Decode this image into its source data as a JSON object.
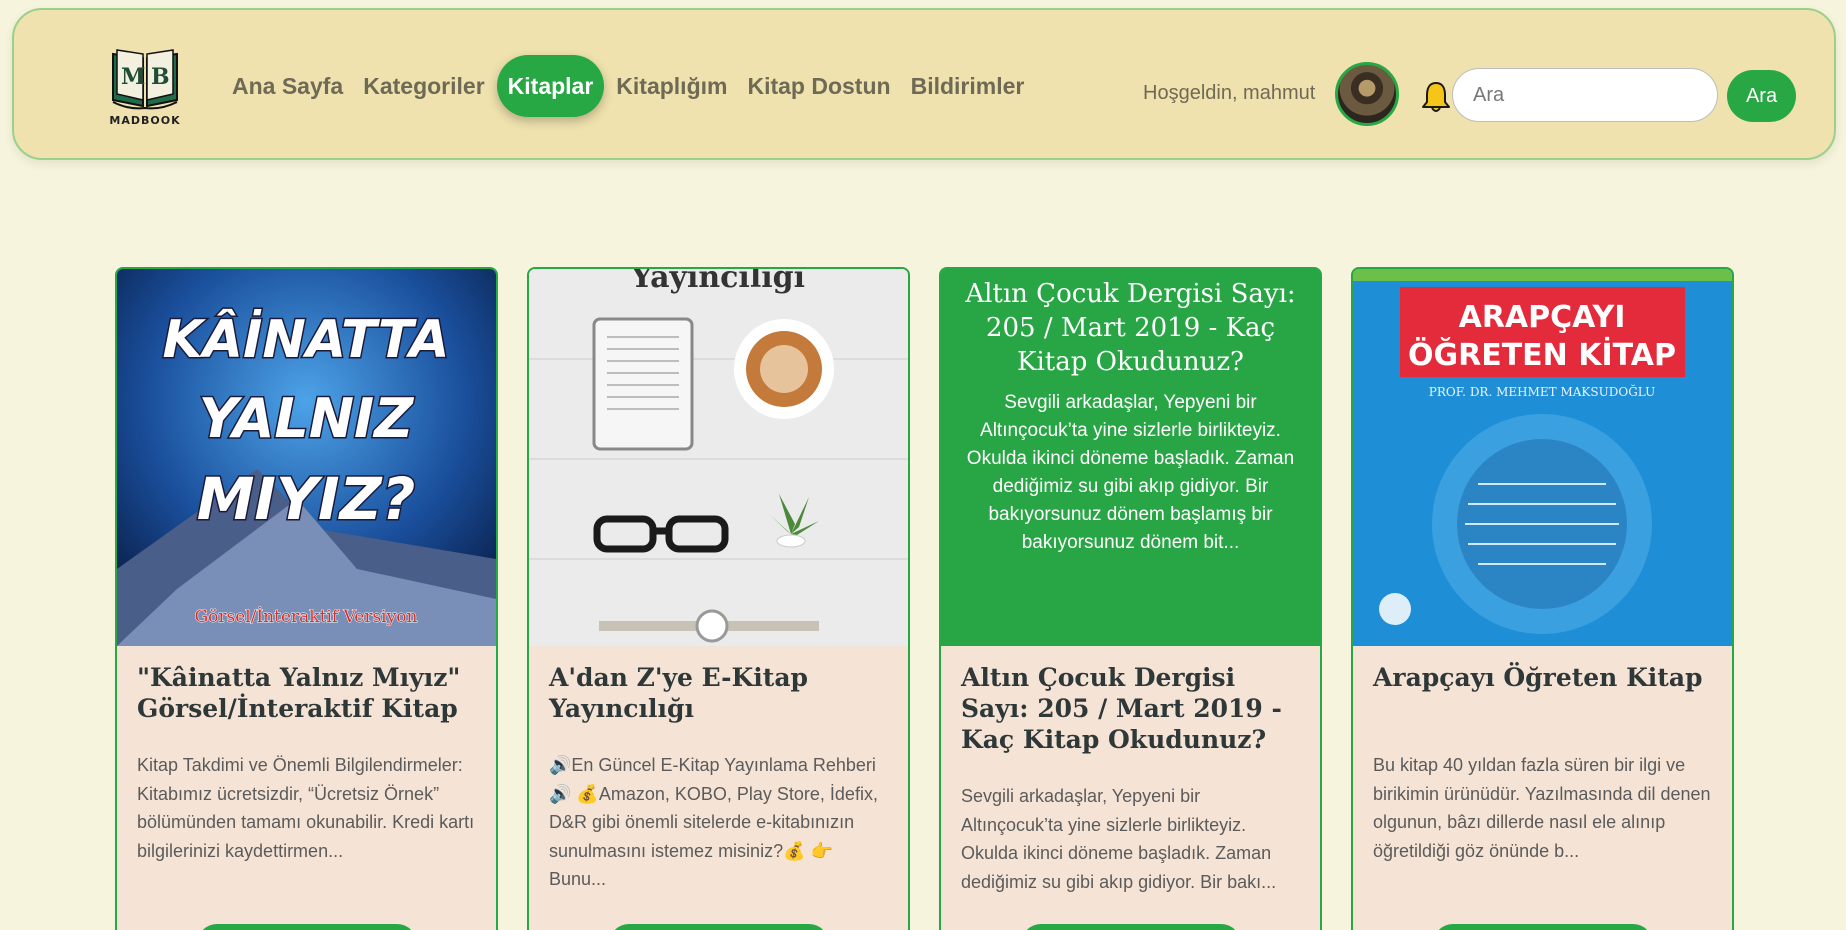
{
  "logo": {
    "monogram": "MB",
    "name": "MADBOOK"
  },
  "nav": [
    {
      "label": "Ana Sayfa"
    },
    {
      "label": "Kategoriler"
    },
    {
      "label": "Kitaplar",
      "active": true
    },
    {
      "label": "Kitaplığım"
    },
    {
      "label": "Kitap Dostun"
    },
    {
      "label": "Bildirimler"
    }
  ],
  "user": {
    "welcome": "Hoşgeldin, mahmut"
  },
  "search": {
    "placeholder": "Ara",
    "button": "Ara"
  },
  "colors": {
    "accent": "#28a745",
    "navbar_bg": "#efe2ae",
    "page_bg": "#f6f4dc",
    "card_bg": "#f5e4d6"
  },
  "cards": [
    {
      "title": "\"Kâinatta Yalnız Mıyız\" Görsel/İnteraktif Kitap",
      "description": "Kitap Takdimi ve Önemli Bilgilendirmeler: Kitabımız ücretsizdir, “Ücretsiz Örnek” bölümünden tamamı okunabilir. Kredi kartı bilgilerinizi kaydettirmen...",
      "cover": {
        "line1": "KÂİNATTA",
        "line2": "YALNIZ",
        "line3": "MIYIZ?",
        "subtitle": "Görsel/İnteraktif Versiyon"
      }
    },
    {
      "title": "A'dan Z'ye E-Kitap Yayıncılığı",
      "description": "🔊En Güncel E-Kitap Yayınlama Rehberi 🔊 💰Amazon, KOBO, Play Store, İdefix, D&R gibi önemli sitelerde e-kitabınızın sunulmasını istemez misiniz?💰 👉 Bunu...",
      "cover": {
        "header": "Yayıncılığı"
      }
    },
    {
      "title": "Altın Çocuk Dergisi Sayı: 205 / Mart 2019 - Kaç Kitap Okudunuz?",
      "description": "Sevgili arkadaşlar, Yepyeni bir Altınçocuk’ta yine sizlerle birlikteyiz. Okulda ikinci döneme başladık. Zaman dediğimiz su gibi akıp gidiyor. Bir bakı...",
      "hover_text": "Sevgili arkadaşlar, Yepyeni bir Altınçocuk’ta yine sizlerle birlikteyiz. Okulda ikinci döneme başladık. Zaman dediğimiz su gibi akıp gidiyor. Bir bakıyorsunuz dönem başlamış bir bakıyorsunuz dönem bit..."
    },
    {
      "title": "Arapçayı Öğreten Kitap",
      "description": "Bu kitap 40 yıldan fazla süren bir ilgi ve birikimin ürünüdür. Yazılmasında dil denen olgunun, bâzı dillerde nasıl ele alınıp öğretildiği göz önünde b...",
      "cover": {
        "line1": "ARAPÇAYI",
        "line2": "ÖĞRETEN KİTAP",
        "author": "PROF. DR. MEHMET MAKSUDOĞLU"
      }
    }
  ]
}
